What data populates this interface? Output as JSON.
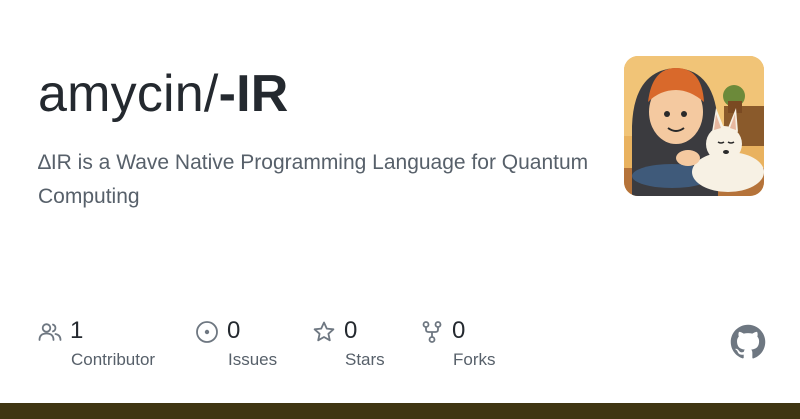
{
  "repo": {
    "owner": "amycin/",
    "name": "-IR",
    "description": "∆IR is a Wave Native Programming Language for Quantum Computing"
  },
  "stats": [
    {
      "count": "1",
      "label": "Contributor",
      "icon": "people-icon"
    },
    {
      "count": "0",
      "label": "Issues",
      "icon": "issue-opened-icon"
    },
    {
      "count": "0",
      "label": "Stars",
      "icon": "star-icon"
    },
    {
      "count": "0",
      "label": "Forks",
      "icon": "repo-forked-icon"
    }
  ],
  "colors": {
    "title": "#24292f",
    "muted": "#57606a",
    "icon": "#6e7781",
    "bottom_bar": "#3f3512"
  },
  "logo_icon": "github-mark-icon"
}
